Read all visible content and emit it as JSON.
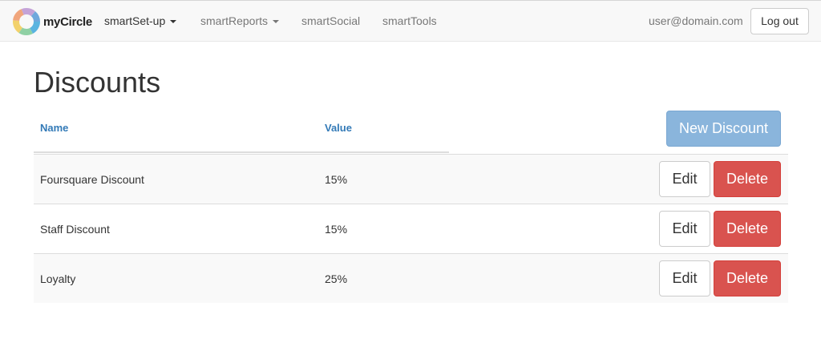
{
  "navbar": {
    "brand": "myCircle",
    "items": [
      {
        "label": "smartSet-up",
        "dropdown": true,
        "active": true
      },
      {
        "label": "smartReports",
        "dropdown": true,
        "active": false
      },
      {
        "label": "smartSocial",
        "dropdown": false,
        "active": false
      },
      {
        "label": "smartTools",
        "dropdown": false,
        "active": false
      }
    ],
    "user": "user@domain.com",
    "logout_label": "Log out"
  },
  "page": {
    "title": "Discounts"
  },
  "table": {
    "columns": [
      "Name",
      "Value"
    ],
    "new_button": "New Discount",
    "edit_label": "Edit",
    "delete_label": "Delete",
    "rows": [
      {
        "name": "Foursquare Discount",
        "value": "15%"
      },
      {
        "name": "Staff Discount",
        "value": "15%"
      },
      {
        "name": "Loyalty",
        "value": "25%"
      }
    ]
  },
  "colors": {
    "link": "#337ab7",
    "primary_disabled": "#8ab5dc",
    "danger": "#d9534f"
  }
}
